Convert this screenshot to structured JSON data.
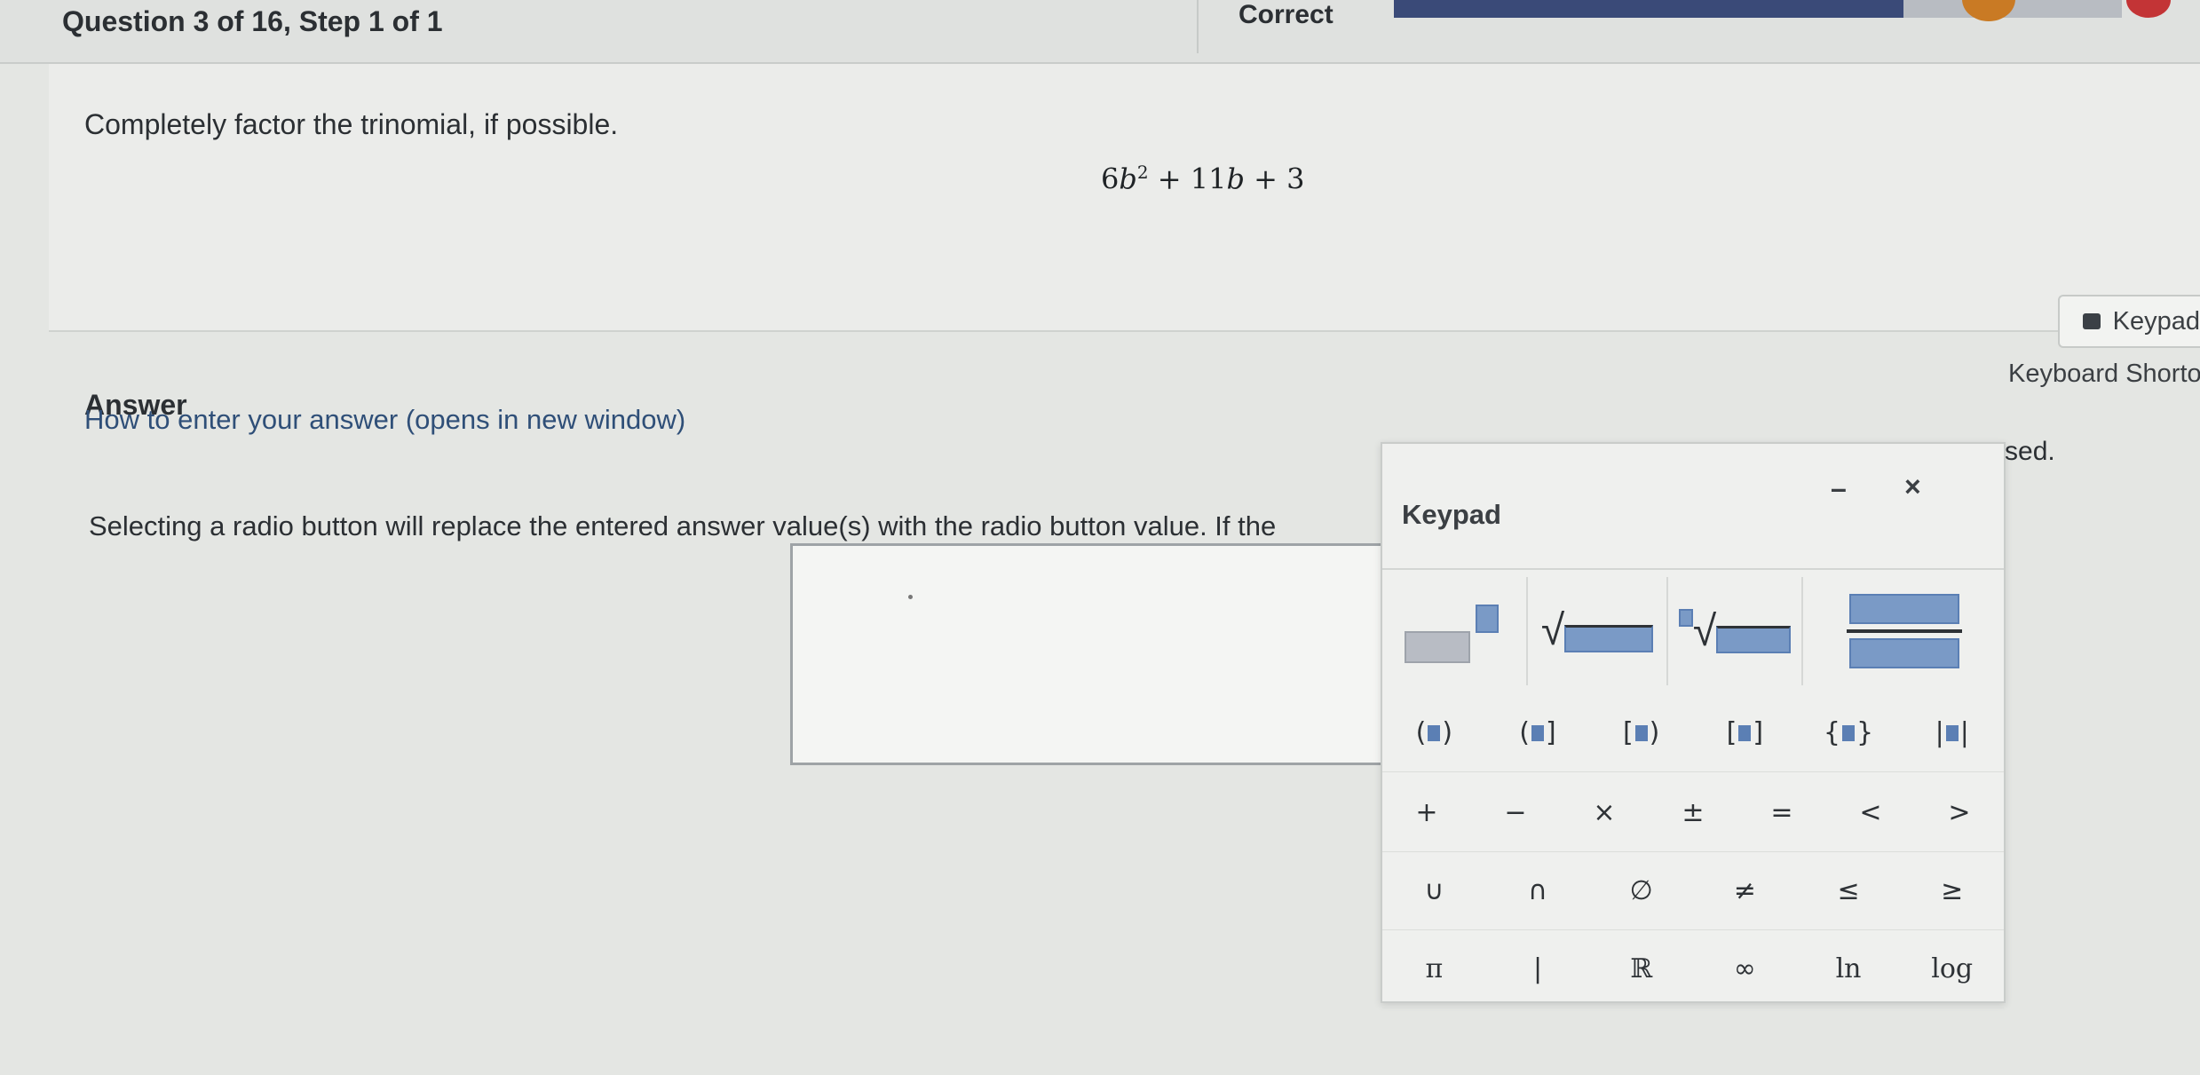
{
  "header": {
    "question_progress": "Question 3 of 16, Step 1 of 1",
    "status": "Correct",
    "progress": 0.7
  },
  "question": {
    "instruction": "Completely factor the trinomial, if possible.",
    "expression": "6b² + 11b + 3"
  },
  "side_controls": {
    "keypad_toggle": "Keypad",
    "keyboard_shortcuts": "Keyboard Shorto"
  },
  "answer": {
    "label": "Answer",
    "how_to_link": "How to enter your answer (opens in new window)",
    "radio_note": "Selecting a radio button will replace the entered answer value(s) with the radio button value. If the",
    "radio_note_tail": "s used.",
    "input_value": ""
  },
  "keypad": {
    "title": "Keypad",
    "minimize": "–",
    "close": "×",
    "template_keys": [
      "exponent-icon",
      "square-root-icon",
      "nth-root-icon",
      "fraction-icon"
    ],
    "bracket_keys": [
      "( )",
      "( ]",
      "[ )",
      "[ ]",
      "{ }",
      "| |"
    ],
    "rows": [
      [
        "+",
        "−",
        "×",
        "±",
        "=",
        "<",
        ">"
      ],
      [
        "∪",
        "∩",
        "∅",
        "≠",
        "≤",
        "≥"
      ],
      [
        "π",
        "|",
        "ℝ",
        "∞",
        "ln",
        "log"
      ]
    ]
  }
}
